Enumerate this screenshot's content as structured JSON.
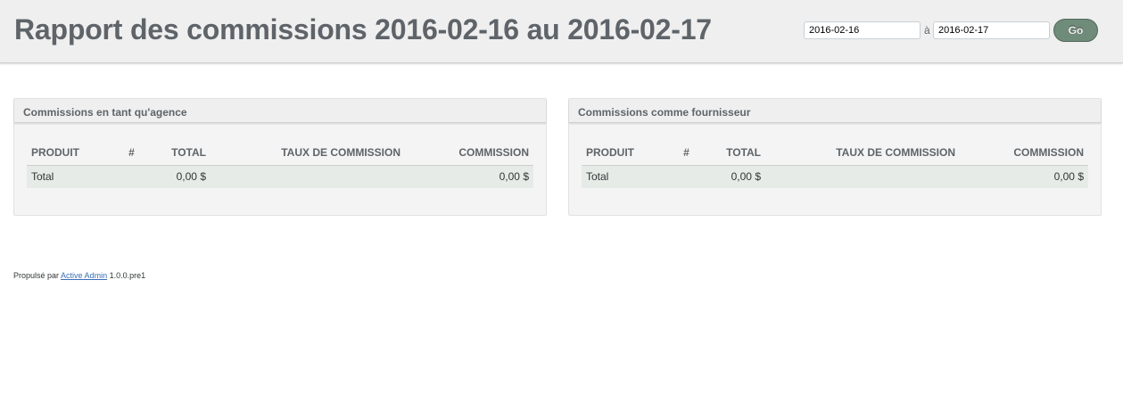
{
  "header": {
    "title": "Rapport des commissions 2016-02-16 au 2016-02-17",
    "from_date": "2016-02-16",
    "separator": "à",
    "to_date": "2016-02-17",
    "go_label": "Go"
  },
  "panels": [
    {
      "title": "Commissions en tant qu'agence",
      "columns": [
        "PRODUIT",
        "#",
        "TOTAL",
        "TAUX DE COMMISSION",
        "COMMISSION"
      ],
      "row": {
        "produit": "Total",
        "count": "",
        "total": "0,00 $",
        "taux": "",
        "commission": "0,00 $"
      }
    },
    {
      "title": "Commissions comme fournisseur",
      "columns": [
        "PRODUIT",
        "#",
        "TOTAL",
        "TAUX DE COMMISSION",
        "COMMISSION"
      ],
      "row": {
        "produit": "Total",
        "count": "",
        "total": "0,00 $",
        "taux": "",
        "commission": "0,00 $"
      }
    }
  ],
  "footer": {
    "prefix": "Propulsé par",
    "link": "Active Admin",
    "version": "1.0.0.pre1"
  }
}
